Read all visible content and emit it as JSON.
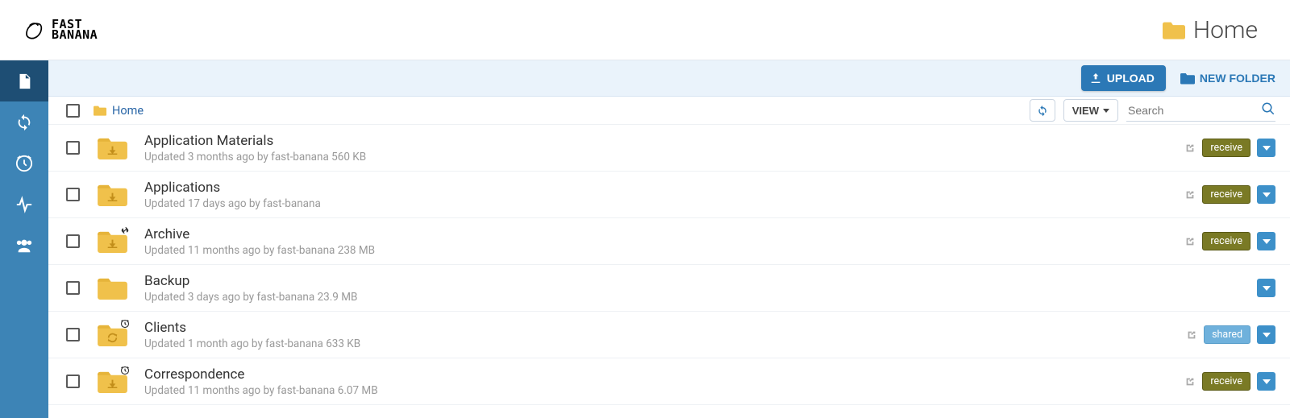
{
  "brand": {
    "line1": "FAST",
    "line2": "BANANA"
  },
  "page_title": "Home",
  "toolbar": {
    "upload": "UPLOAD",
    "new_folder": "NEW FOLDER"
  },
  "controls": {
    "view": "VIEW",
    "search_placeholder": "Search",
    "breadcrumb": "Home"
  },
  "rows": [
    {
      "name": "Application Materials",
      "meta": "Updated 3 months ago by fast-banana 560 KB",
      "icon": "download",
      "overlay": "",
      "share": true,
      "badge": "receive",
      "badge_class": "badge-receive"
    },
    {
      "name": "Applications",
      "meta": "Updated 17 days ago by fast-banana",
      "icon": "download",
      "overlay": "",
      "share": true,
      "badge": "receive",
      "badge_class": "badge-receive"
    },
    {
      "name": "Archive",
      "meta": "Updated 11 months ago by fast-banana 238 MB",
      "icon": "download",
      "overlay": "link",
      "share": true,
      "badge": "receive",
      "badge_class": "badge-receive"
    },
    {
      "name": "Backup",
      "meta": "Updated 3 days ago by fast-banana 23.9 MB",
      "icon": "plain",
      "overlay": "",
      "share": false,
      "badge": "",
      "badge_class": ""
    },
    {
      "name": "Clients",
      "meta": "Updated 1 month ago by fast-banana 633 KB",
      "icon": "sync",
      "overlay": "clock",
      "share": true,
      "badge": "shared",
      "badge_class": "badge-shared"
    },
    {
      "name": "Correspondence",
      "meta": "Updated 11 months ago by fast-banana 6.07 MB",
      "icon": "download",
      "overlay": "clock",
      "share": true,
      "badge": "receive",
      "badge_class": "badge-receive"
    }
  ]
}
